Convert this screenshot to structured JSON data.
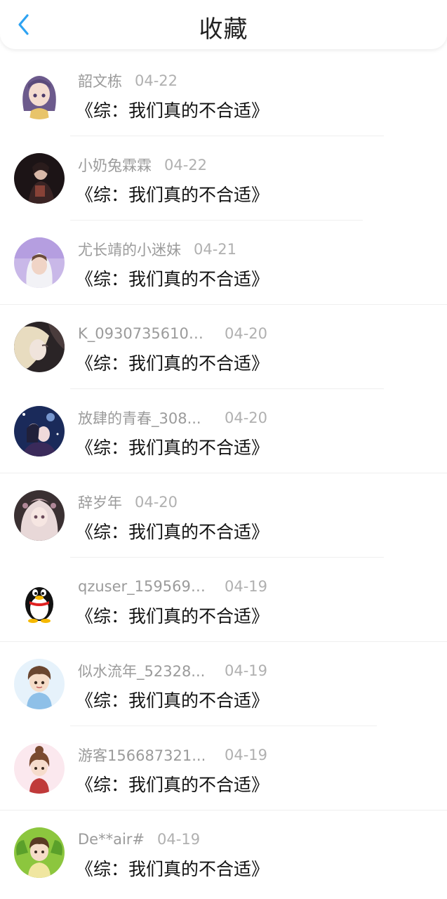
{
  "header": {
    "title": "收藏",
    "back_icon": "chevron-left-icon",
    "accent_color": "#2ea3f2"
  },
  "items": [
    {
      "name": "韶文栋",
      "date": "04-22",
      "book": "《综：我们真的不合适》",
      "avatar": "anime-girl-purple"
    },
    {
      "name": "小奶兔霖霖",
      "date": "04-22",
      "book": "《综：我们真的不合适》",
      "avatar": "dark-portrait"
    },
    {
      "name": "尤长靖的小迷妹",
      "date": "04-21",
      "book": "《综：我们真的不合适》",
      "avatar": "boy-white-hoodie"
    },
    {
      "name": "K_09307356101...",
      "date": "04-20",
      "book": "《综：我们真的不合适》",
      "avatar": "anime-blonde"
    },
    {
      "name": "放肆的青春_308...",
      "date": "04-20",
      "book": "《综：我们真的不合适》",
      "avatar": "anime-couple-night"
    },
    {
      "name": "辞岁年",
      "date": "04-20",
      "book": "《综：我们真的不合适》",
      "avatar": "anime-girl-lace"
    },
    {
      "name": "qzuser_1595695...",
      "date": "04-19",
      "book": "《综：我们真的不合适》",
      "avatar": "qq-penguin"
    },
    {
      "name": "似水流年_52328...",
      "date": "04-19",
      "book": "《综：我们真的不合适》",
      "avatar": "chibi-boy-blue"
    },
    {
      "name": "游客156687321...",
      "date": "04-19",
      "book": "《综：我们真的不合适》",
      "avatar": "chibi-girl-red"
    },
    {
      "name": "De**air#",
      "date": "04-19",
      "book": "《综：我们真的不合适》",
      "avatar": "chibi-boy-green"
    }
  ]
}
